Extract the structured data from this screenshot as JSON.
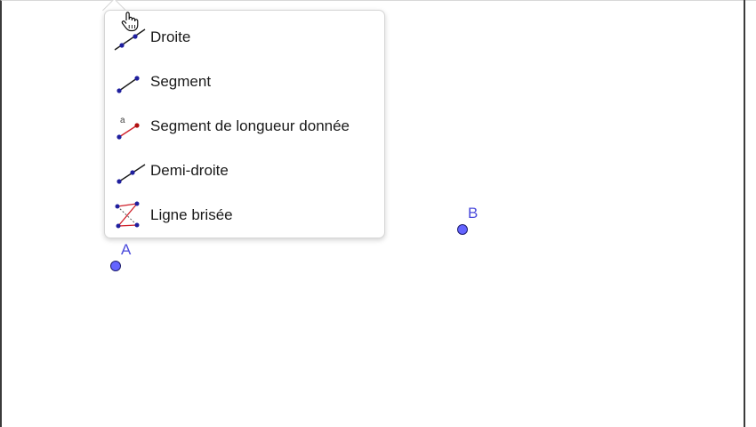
{
  "tool_menu": {
    "items": [
      {
        "label": "Droite",
        "icon": "line-through-two-points-icon"
      },
      {
        "label": "Segment",
        "icon": "segment-icon"
      },
      {
        "label": "Segment de longueur donnée",
        "icon": "segment-fixed-length-icon",
        "icon_text": "a"
      },
      {
        "label": "Demi-droite",
        "icon": "ray-icon"
      },
      {
        "label": "Ligne brisée",
        "icon": "polyline-icon"
      }
    ]
  },
  "canvas": {
    "points": [
      {
        "name": "A"
      },
      {
        "name": "B"
      }
    ]
  },
  "colors": {
    "point_fill": "#6464ff",
    "point_label": "#4b4bdc",
    "icon_point": "#1f1f9e",
    "icon_red": "#d0202a"
  }
}
